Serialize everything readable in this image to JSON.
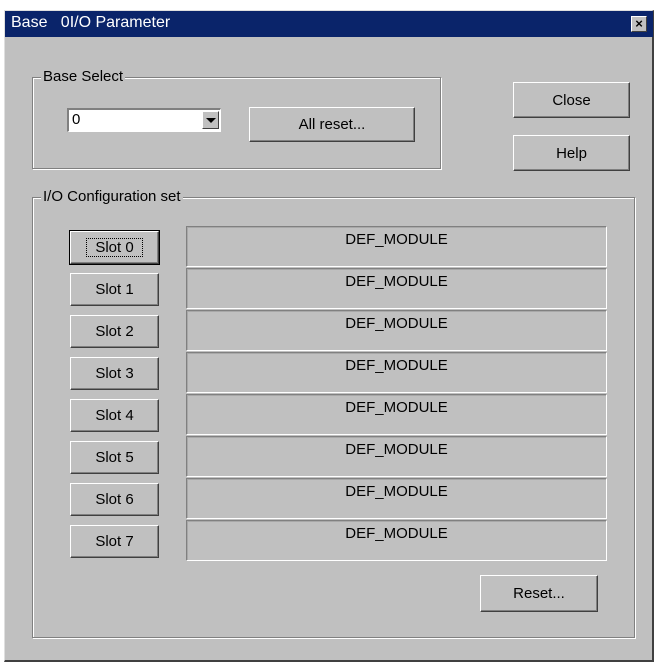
{
  "window": {
    "title": "Base   0I/O Parameter",
    "close_glyph": "×"
  },
  "base_select": {
    "group_label": "Base Select",
    "selected_value": "0",
    "all_reset_label": "All reset..."
  },
  "buttons": {
    "close_label": "Close",
    "help_label": "Help",
    "reset_label": "Reset..."
  },
  "io_config": {
    "group_label": "I/O Configuration set",
    "slots": [
      {
        "label": "Slot 0",
        "module": "DEF_MODULE"
      },
      {
        "label": "Slot 1",
        "module": "DEF_MODULE"
      },
      {
        "label": "Slot 2",
        "module": "DEF_MODULE"
      },
      {
        "label": "Slot 3",
        "module": "DEF_MODULE"
      },
      {
        "label": "Slot 4",
        "module": "DEF_MODULE"
      },
      {
        "label": "Slot 5",
        "module": "DEF_MODULE"
      },
      {
        "label": "Slot 6",
        "module": "DEF_MODULE"
      },
      {
        "label": "Slot 7",
        "module": "DEF_MODULE"
      }
    ]
  },
  "colors": {
    "titlebar": "#0a246a",
    "face": "#c0c0c0"
  }
}
